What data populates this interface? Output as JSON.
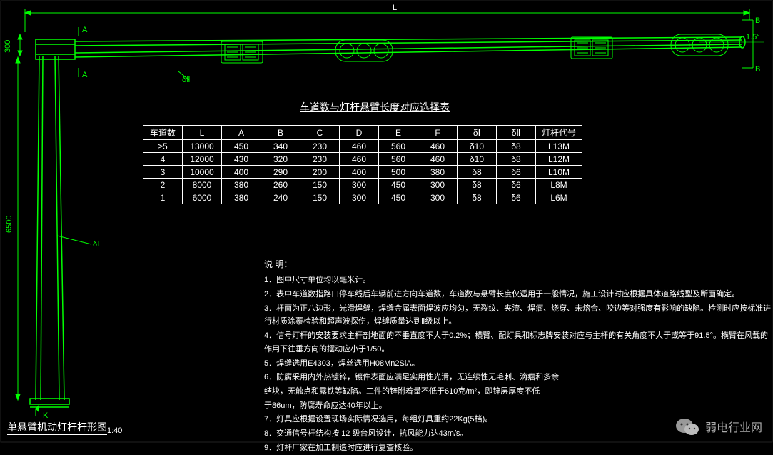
{
  "drawing": {
    "bottom_label": "单悬臂机动灯杆杆形图",
    "bottom_scale": "1:40",
    "dims": {
      "L": "L",
      "height": "6500",
      "top_h": "300",
      "angle": "1.5°",
      "sectA": "A",
      "sectB": "B",
      "sectK": "K",
      "deltaI": "δⅠ",
      "deltaII": "δⅡ"
    }
  },
  "table": {
    "title": "车道数与灯杆悬臂长度对应选择表",
    "headers": [
      "车道数",
      "L",
      "A",
      "B",
      "C",
      "D",
      "E",
      "F",
      "δⅠ",
      "δⅡ",
      "灯杆代号"
    ],
    "rows": [
      [
        "≥5",
        "13000",
        "450",
        "340",
        "230",
        "460",
        "560",
        "460",
        "δ10",
        "δ8",
        "L13M"
      ],
      [
        "4",
        "12000",
        "430",
        "320",
        "230",
        "460",
        "560",
        "460",
        "δ10",
        "δ8",
        "L12M"
      ],
      [
        "3",
        "10000",
        "400",
        "290",
        "200",
        "400",
        "500",
        "380",
        "δ8",
        "δ6",
        "L10M"
      ],
      [
        "2",
        "8000",
        "380",
        "260",
        "150",
        "300",
        "450",
        "300",
        "δ8",
        "δ6",
        "L8M"
      ],
      [
        "1",
        "6000",
        "380",
        "240",
        "150",
        "300",
        "450",
        "300",
        "δ8",
        "δ6",
        "L6M"
      ]
    ]
  },
  "notes": {
    "title": "说  明：",
    "items": [
      "1．图中尺寸单位均以毫米计。",
      "2．表中车道数指路口停车线后车辆前进方向车道数，车道数与悬臂长度仅适用于一般情况，施工设计时应根据具体道路线型及断面确定。",
      "3．杆面为正八边形，光滑焊缝，焊缝金属表面焊波应均匀，无裂纹、夹渣、焊瘤、烧穿、未熔合、咬边等对强度有影响的缺陷。检测时应按标准进行材质涂覆检验和超声波探伤，焊缝质量达到Ⅱ级以上。",
      "4．信号灯杆的安装要求主杆剖地面的不垂直度不大于0.2%；横臂、配灯具和标志牌安装对应与主杆的有关角度不大于或等于91.5°。横臂在风载的作用下往垂方向的摆动应小于1/50。",
      "5．焊缝选用E4303，焊丝选用H08Mn2SiA。",
      "6．防腐采用内外热镀锌，镀件表面应满足实用性光滑，无连续性无毛刺、滴瘤和多余",
      "   结块，无触点和露铁等缺陷。工件的锌附着量不低于610克/m²，即锌层厚度不低",
      "   于86um，防腐寿命应达40年以上。",
      "7．灯具应根据设置现场实际情况选用，每组灯具重约22Kg(5档)。",
      "8．交通信号杆结构按 12 级台风设计，抗风能力达43m/s。",
      "9．灯杆厂家在加工制造时应进行复查核验。"
    ]
  },
  "wechat": {
    "label": "弱电行业网"
  }
}
